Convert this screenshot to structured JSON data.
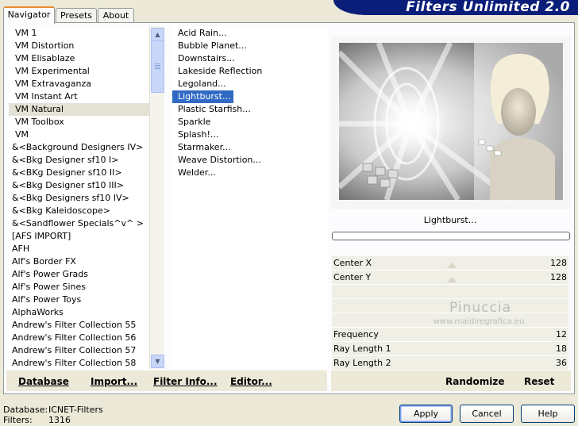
{
  "tabs": [
    "Navigator",
    "Presets",
    "About"
  ],
  "header_title": "Filters Unlimited 2.0",
  "categories": [
    "VM 1",
    "VM Distortion",
    "VM Elisablaze",
    "VM Experimental",
    "VM Extravaganza",
    "VM Instant Art",
    "VM Natural",
    "VM Toolbox",
    "VM",
    "&<Background Designers IV>",
    "&<Bkg Designer sf10 I>",
    "&<BKg Designer sf10 II>",
    "&<Bkg Designer sf10 III>",
    "&<Bkg Designers sf10 IV>",
    "&<Bkg Kaleidoscope>",
    "&<Sandflower Specials^v^ >",
    "[AFS IMPORT]",
    "AFH",
    "Alf's Border FX",
    "Alf's Power Grads",
    "Alf's Power Sines",
    "Alf's Power Toys",
    "AlphaWorks",
    "Andrew's Filter Collection 55",
    "Andrew's Filter Collection 56",
    "Andrew's Filter Collection 57",
    "Andrew's Filter Collection 58"
  ],
  "selected_category": "VM Natural",
  "filters": [
    "Acid Rain...",
    "Bubble Planet...",
    "Downstairs...",
    "Lakeside Reflection",
    "Legoland...",
    "Lightburst...",
    "Plastic Starfish...",
    "Sparkle",
    "Splash!...",
    "Starmaker...",
    "Weave Distortion...",
    "Welder..."
  ],
  "selected_filter": "Lightburst...",
  "filter_title": "Lightburst...",
  "params": {
    "center_x": {
      "label": "Center X",
      "value": "128"
    },
    "center_y": {
      "label": "Center Y",
      "value": "128"
    },
    "frequency": {
      "label": "Frequency",
      "value": "12"
    },
    "ray_length_1": {
      "label": "Ray Length 1",
      "value": "18"
    },
    "ray_length_2": {
      "label": "Ray Length 2",
      "value": "36"
    }
  },
  "watermark": {
    "name": "Pinuccia",
    "url": "www.maidiregrafica.eu"
  },
  "left_buttons": {
    "database": "Database",
    "import": "Import...",
    "filter_info": "Filter Info...",
    "editor": "Editor..."
  },
  "right_buttons": {
    "randomize": "Randomize",
    "reset": "Reset"
  },
  "status": {
    "database_label": "Database:",
    "database_value": "ICNET-Filters",
    "filters_label": "Filters:",
    "filters_value": "1316"
  },
  "dialog_buttons": {
    "apply": "Apply",
    "cancel": "Cancel",
    "help": "Help"
  },
  "colors": {
    "selection": "#316ac5",
    "banner": "#0a1d79",
    "face": "#ece9d8"
  },
  "icons": {
    "scroll_up": "scroll-up-arrow-icon",
    "scroll_down": "scroll-down-arrow-icon"
  }
}
